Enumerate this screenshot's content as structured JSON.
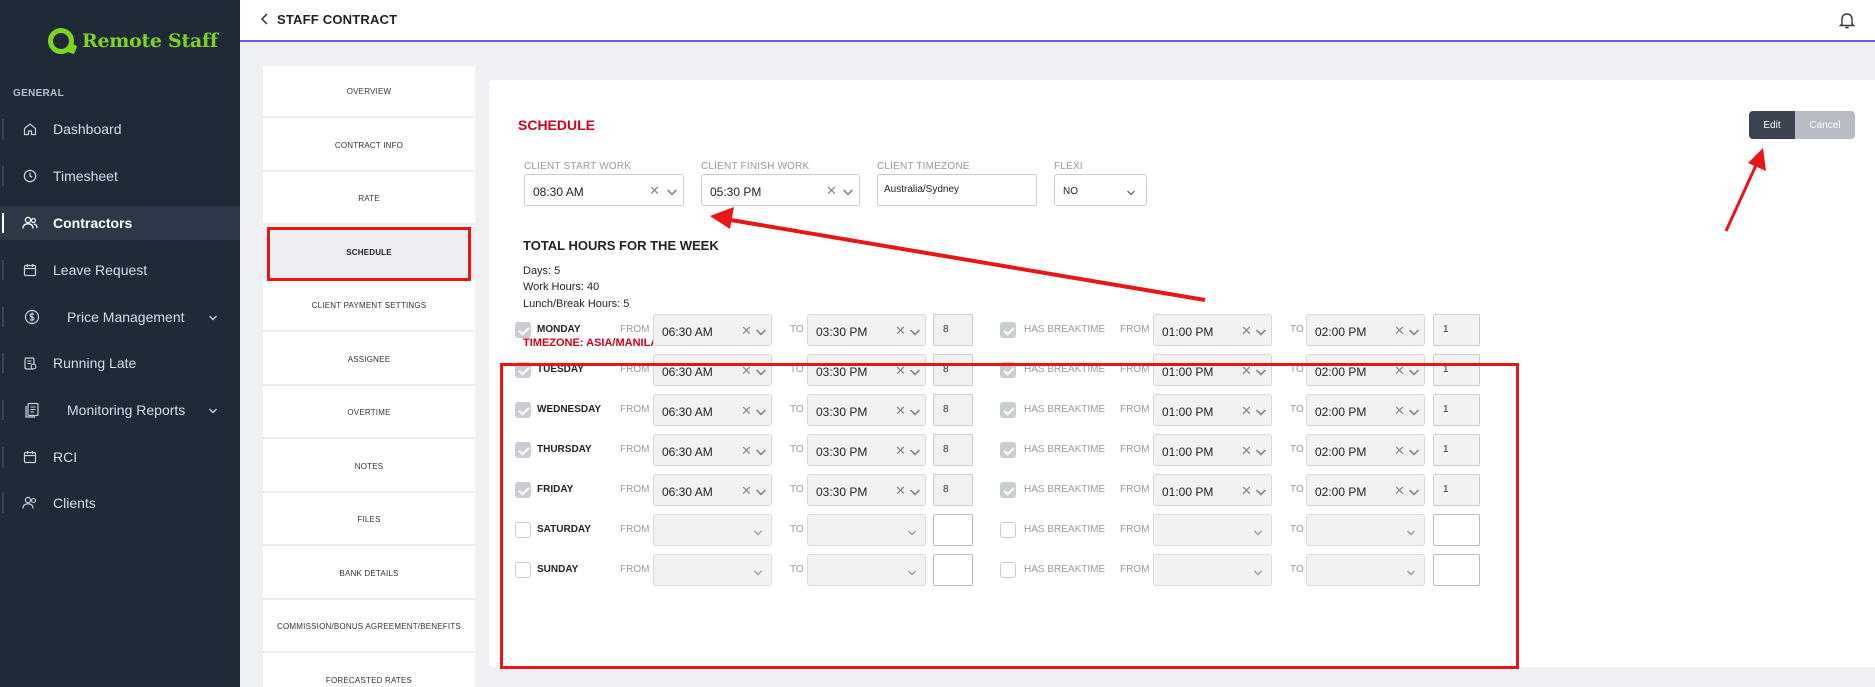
{
  "app": {
    "logo_text": "Remote Staff",
    "page_title": "STAFF CONTRACT"
  },
  "sidebar": {
    "section_label": "GENERAL",
    "items": [
      {
        "label": "Dashboard",
        "icon": "home-icon"
      },
      {
        "label": "Timesheet",
        "icon": "clock-icon"
      },
      {
        "label": "Contractors",
        "icon": "users-icon",
        "active": true
      },
      {
        "label": "Leave Request",
        "icon": "calendar-icon"
      },
      {
        "label": "Price Management",
        "icon": "dollar-icon",
        "expandable": true
      },
      {
        "label": "Running Late",
        "icon": "stopwatch-icon"
      },
      {
        "label": "Monitoring Reports",
        "icon": "report-icon",
        "expandable": true
      },
      {
        "label": "RCI",
        "icon": "calendar-icon"
      },
      {
        "label": "Clients",
        "icon": "users-icon"
      }
    ]
  },
  "tabs": [
    {
      "label": "OVERVIEW"
    },
    {
      "label": "CONTRACT INFO"
    },
    {
      "label": "RATE"
    },
    {
      "label": "SCHEDULE",
      "active": true
    },
    {
      "label": "CLIENT PAYMENT SETTINGS"
    },
    {
      "label": "ASSIGNEE"
    },
    {
      "label": "OVERTIME"
    },
    {
      "label": "NOTES"
    },
    {
      "label": "FILES"
    },
    {
      "label": "BANK DETAILS"
    },
    {
      "label": "COMMISSION/BONUS AGREEMENT/BENEFITS"
    },
    {
      "label": "FORECASTED RATES"
    }
  ],
  "schedule": {
    "title": "SCHEDULE",
    "edit_label": "Edit",
    "cancel_label": "Cancel",
    "client_start_label": "CLIENT START WORK",
    "client_start_value": "08:30 AM",
    "client_finish_label": "CLIENT FINISH WORK",
    "client_finish_value": "05:30 PM",
    "client_tz_label": "CLIENT TIMEZONE",
    "client_tz_value": "Australia/Sydney",
    "flexi_label": "FLEXI",
    "flexi_value": "NO",
    "totals_title": "TOTAL HOURS FOR THE WEEK",
    "days_text": "Days: 5",
    "work_hours_text": "Work Hours: 40",
    "break_hours_text": "Lunch/Break Hours: 5",
    "timezone_title": "TIMEZONE: ASIA/MANILA",
    "from_label": "FROM",
    "to_label": "TO",
    "has_breaktime_label": "HAS BREAKTIME",
    "days": [
      {
        "name": "MONDAY",
        "enabled": true,
        "from": "06:30 AM",
        "to": "03:30 PM",
        "hours": "8",
        "break": true,
        "break_from": "01:00 PM",
        "break_to": "02:00 PM",
        "break_hours": "1"
      },
      {
        "name": "TUESDAY",
        "enabled": true,
        "from": "06:30 AM",
        "to": "03:30 PM",
        "hours": "8",
        "break": true,
        "break_from": "01:00 PM",
        "break_to": "02:00 PM",
        "break_hours": "1"
      },
      {
        "name": "WEDNESDAY",
        "enabled": true,
        "from": "06:30 AM",
        "to": "03:30 PM",
        "hours": "8",
        "break": true,
        "break_from": "01:00 PM",
        "break_to": "02:00 PM",
        "break_hours": "1"
      },
      {
        "name": "THURSDAY",
        "enabled": true,
        "from": "06:30 AM",
        "to": "03:30 PM",
        "hours": "8",
        "break": true,
        "break_from": "01:00 PM",
        "break_to": "02:00 PM",
        "break_hours": "1"
      },
      {
        "name": "FRIDAY",
        "enabled": true,
        "from": "06:30 AM",
        "to": "03:30 PM",
        "hours": "8",
        "break": true,
        "break_from": "01:00 PM",
        "break_to": "02:00 PM",
        "break_hours": "1"
      },
      {
        "name": "SATURDAY",
        "enabled": false,
        "from": "",
        "to": "",
        "hours": "",
        "break": false,
        "break_from": "",
        "break_to": "",
        "break_hours": ""
      },
      {
        "name": "SUNDAY",
        "enabled": false,
        "from": "",
        "to": "",
        "hours": "",
        "break": false,
        "break_from": "",
        "break_to": "",
        "break_hours": ""
      }
    ]
  },
  "colors": {
    "sidebar_bg": "#1e2a38",
    "brand_green": "#7ed321",
    "accent_red": "#d0021b",
    "annotation_red": "#e81616",
    "topbar_border": "#6b5be6"
  }
}
